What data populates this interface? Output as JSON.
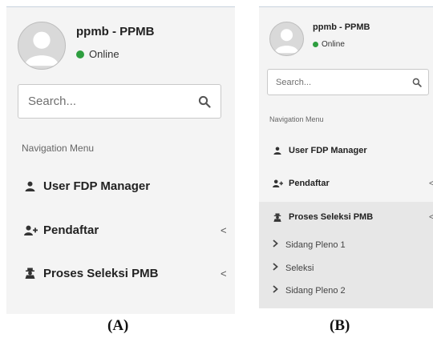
{
  "panel_a": {
    "user_name": "ppmb - PPMB",
    "status": "Online",
    "search_placeholder": "Search...",
    "nav_header": "Navigation Menu",
    "items": [
      {
        "label": "User FDP Manager"
      },
      {
        "label": "Pendaftar",
        "chevron": "<"
      },
      {
        "label": "Proses Seleksi PMB",
        "chevron": "<"
      }
    ]
  },
  "panel_b": {
    "user_name": "ppmb - PPMB",
    "status": "Online",
    "search_placeholder": "Search...",
    "nav_header": "Navigation Menu",
    "items": [
      {
        "label": "User FDP Manager"
      },
      {
        "label": "Pendaftar",
        "chevron": "<"
      },
      {
        "label": "Proses Seleksi PMB",
        "chevron": "<"
      }
    ],
    "sub_items": [
      {
        "label": "Sidang Pleno 1"
      },
      {
        "label": "Seleksi"
      },
      {
        "label": "Sidang Pleno 2"
      }
    ]
  },
  "captions": {
    "a": "(A)",
    "b": "(B)"
  },
  "colors": {
    "online": "#2e9e3f",
    "sidebar_bg": "#f4f4f4",
    "active_bg": "#e7e7e7"
  }
}
